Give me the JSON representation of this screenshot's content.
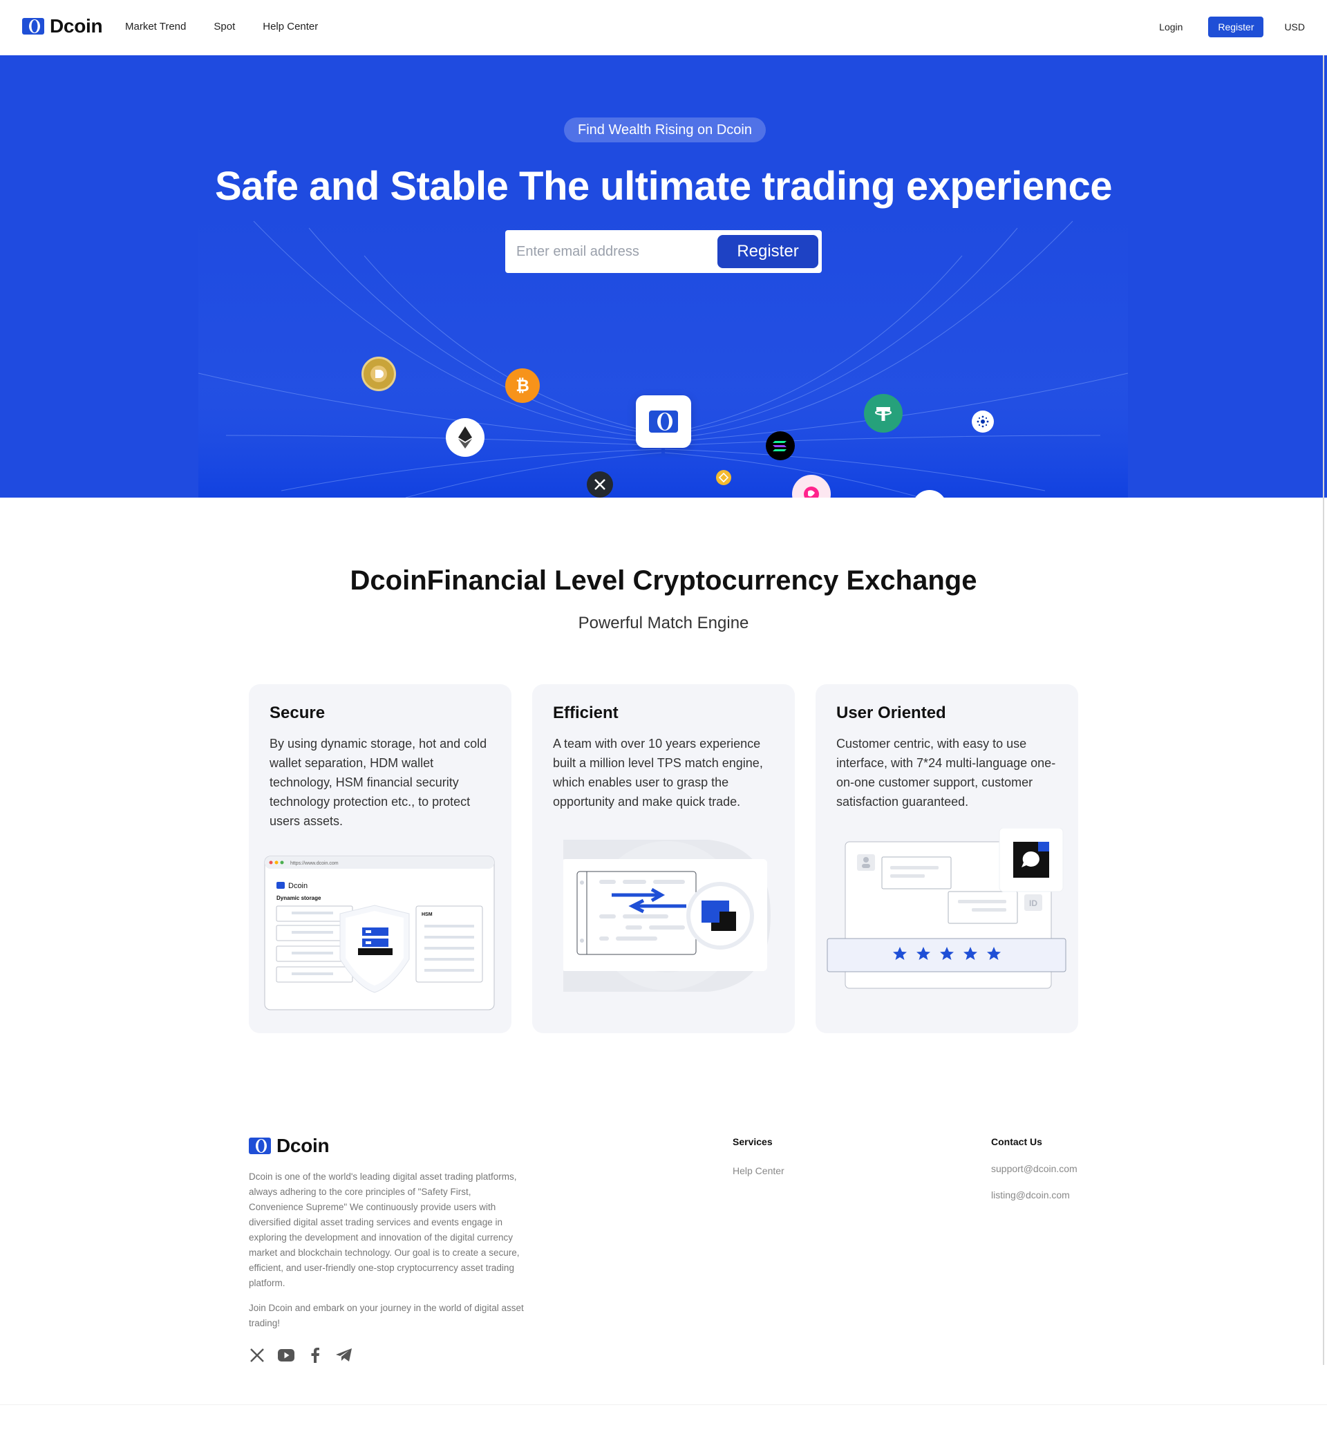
{
  "brand": {
    "name": "Dcoin",
    "accent_color": "#1f4fd6",
    "hero_color": "#1f4be0"
  },
  "nav": {
    "links": [
      "Market Trend",
      "Spot",
      "Help Center"
    ],
    "login": "Login",
    "register": "Register",
    "currency": "USD"
  },
  "hero": {
    "badge": "Find Wealth Rising on Dcoin",
    "title": "Safe and Stable The ultimate trading experience",
    "email_placeholder": "Enter email address",
    "submit": "Register",
    "coin_icons": [
      "dogecoin-icon",
      "bitcoin-icon",
      "ethereum-icon",
      "xrp-icon",
      "bnb-icon",
      "solana-icon",
      "uniswap-icon",
      "tether-icon",
      "polkadot-icon",
      "cardano-icon"
    ]
  },
  "features": {
    "title": "DcoinFinancial Level Cryptocurrency Exchange",
    "subtitle": "Powerful Match Engine",
    "cards": [
      {
        "title": "Secure",
        "body": "By using dynamic storage, hot and cold wallet separation, HDM wallet technology, HSM financial security technology protection etc., to protect users assets.",
        "illus": {
          "url": "https://www.dcoin.com",
          "brand": "Dcoin",
          "label": "Dynamic storage",
          "hsm": "HSM"
        }
      },
      {
        "title": "Efficient",
        "body": "A team with over 10 years experience built a million level TPS match engine, which enables user to grasp the opportunity and make quick trade."
      },
      {
        "title": "User Oriented",
        "body": "Customer centric, with easy to use interface, with 7*24 multi-language one-on-one customer support, customer satisfaction guaranteed.",
        "rating": 5
      }
    ]
  },
  "footer": {
    "brand": "Dcoin",
    "description": "Dcoin is one of the world's leading digital asset trading platforms, always adhering to the core principles of \"Safety First, Convenience Supreme\" We continuously provide users with diversified digital asset trading services and events engage in exploring the development and innovation of the digital currency market and blockchain technology. Our goal is to create a secure, efficient, and user-friendly one-stop cryptocurrency asset trading platform.",
    "join": "Join Dcoin and embark on your journey in the world of digital asset trading!",
    "services_title": "Services",
    "services_links": [
      "Help Center"
    ],
    "contact_title": "Contact Us",
    "contact_links": [
      "support@dcoin.com",
      "listing@dcoin.com"
    ],
    "social_icons": [
      "x-icon",
      "youtube-icon",
      "facebook-icon",
      "telegram-icon"
    ]
  }
}
